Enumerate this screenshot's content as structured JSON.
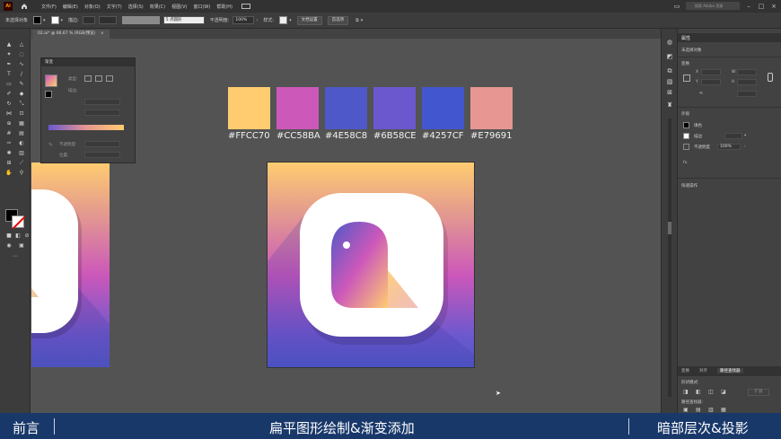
{
  "app": {
    "logo": "Ai"
  },
  "menu": {
    "items": [
      "文件(F)",
      "编辑(E)",
      "对象(O)",
      "文字(T)",
      "选择(S)",
      "效果(C)",
      "视图(V)",
      "窗口(W)",
      "帮助(H)"
    ],
    "search_placeholder": "搜索 Adobe 资源"
  },
  "control_bar": {
    "selection_label": "未选择对象",
    "stroke_label": "描边:",
    "brush_value": "5 点圆形",
    "opacity_label": "不透明度:",
    "opacity_value": "100%",
    "style_label": "样式:",
    "doc_setup_button": "文档设置",
    "prefs_button": "首选项"
  },
  "document_tab": {
    "label": "02.ai* @ 66.67 % (RGB/预览)"
  },
  "gradient_panel": {
    "title": "渐变",
    "type_label": "类型:",
    "stroke_label": "描边:",
    "opacity_label": "不透明度:",
    "location_label": "位置:"
  },
  "swatches": [
    {
      "color": "#FFCC70",
      "label": "#FFCC70"
    },
    {
      "color": "#CC58BA",
      "label": "#CC58BA"
    },
    {
      "color": "#4E58C8",
      "label": "#4E58C8"
    },
    {
      "color": "#6B58CE",
      "label": "#6B58CE"
    },
    {
      "color": "#4257CF",
      "label": "#4257CF"
    },
    {
      "color": "#E79691",
      "label": "#E79691"
    }
  ],
  "properties_panel": {
    "tab": "属性",
    "no_selection": "未选择对象",
    "transform_title": "变换",
    "appearance_title": "外观",
    "fill_label": "填色",
    "stroke_label": "描边",
    "opacity_label": "不透明度",
    "opacity_value": "100%",
    "fx_label": "fx.",
    "quick_actions_title": "快速操作"
  },
  "pathfinder_panel": {
    "tabs": [
      "变换",
      "对齐",
      "路径查找器"
    ],
    "shape_modes_label": "形状模式:",
    "expand_button": "扩展",
    "pathfinders_label": "路径查找器:"
  },
  "caption": {
    "left": "前言",
    "center": "扁平图形绘制&渐变添加",
    "right": "暗部层次&投影"
  }
}
